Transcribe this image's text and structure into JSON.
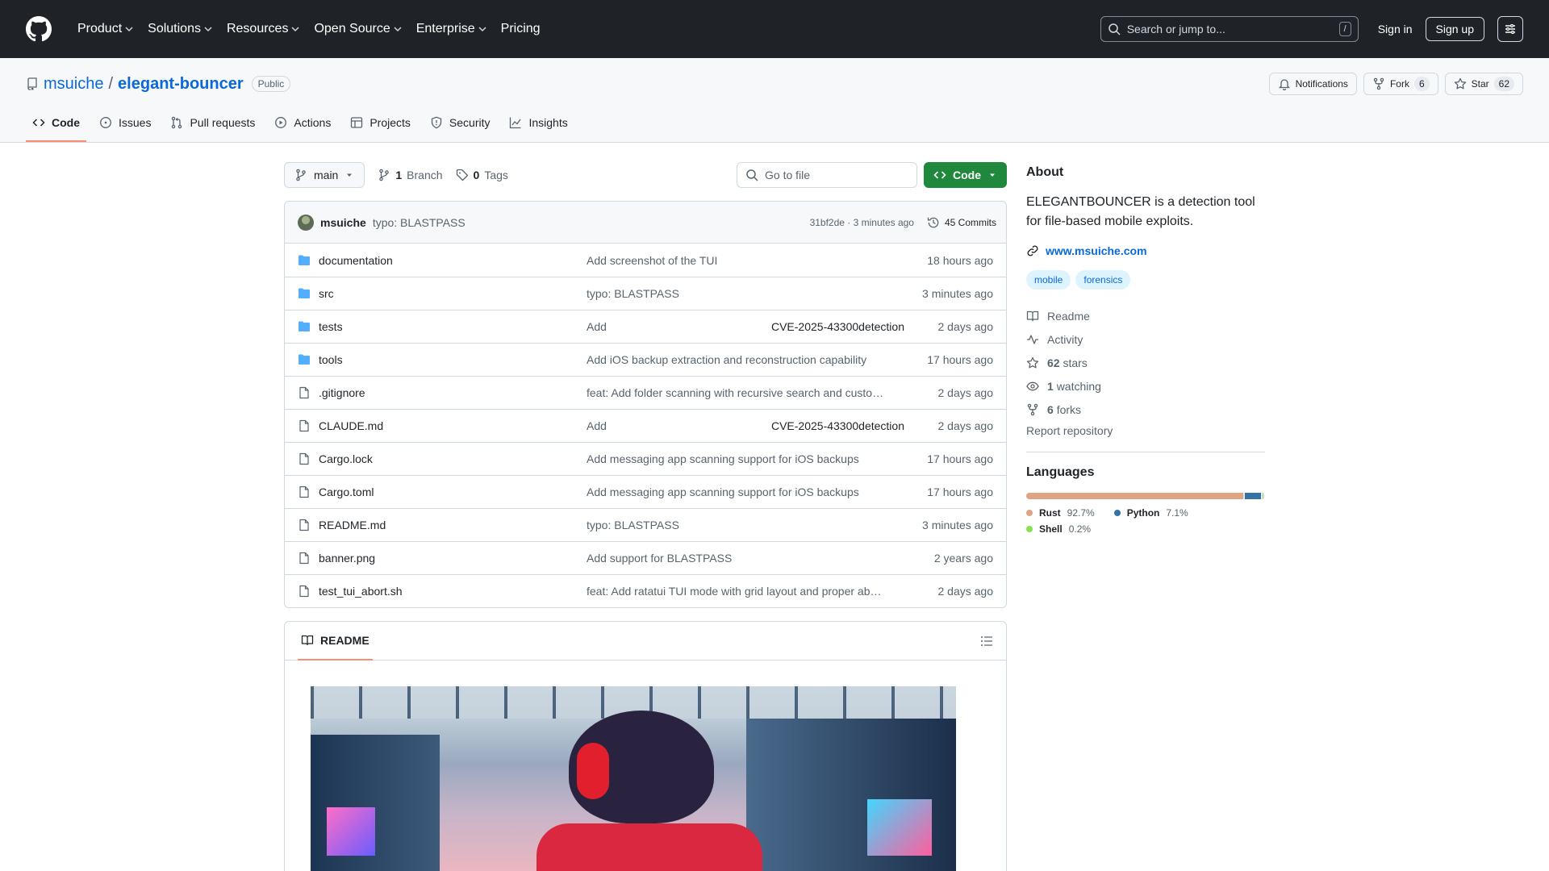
{
  "header": {
    "nav": [
      "Product",
      "Solutions",
      "Resources",
      "Open Source",
      "Enterprise",
      "Pricing"
    ],
    "search_placeholder": "Search or jump to...",
    "search_kbd": "/",
    "sign_in": "Sign in",
    "sign_up": "Sign up"
  },
  "repo": {
    "owner": "msuiche",
    "separator": "/",
    "name": "elegant-bouncer",
    "visibility": "Public",
    "notifications_label": "Notifications",
    "fork_label": "Fork",
    "fork_count": "6",
    "star_label": "Star",
    "star_count": "62"
  },
  "tabs": [
    "Code",
    "Issues",
    "Pull requests",
    "Actions",
    "Projects",
    "Security",
    "Insights"
  ],
  "file_nav": {
    "branch": "main",
    "branch_count": "1",
    "branch_label": "Branch",
    "tag_count": "0",
    "tag_label": "Tags",
    "goto_placeholder": "Go to file",
    "code_label": "Code"
  },
  "last_commit": {
    "author": "msuiche",
    "message": "typo: BLASTPASS",
    "sha_time": "31bf2de · 3 minutes ago",
    "commits_label": "45 Commits"
  },
  "files": [
    {
      "type": "dir",
      "name": "documentation",
      "commit": "Add screenshot of the TUI",
      "time": "18 hours ago"
    },
    {
      "type": "dir",
      "name": "src",
      "commit": "typo: BLASTPASS",
      "time": "3 minutes ago"
    },
    {
      "type": "dir",
      "name": "tests",
      "commit_pre": "Add ",
      "commit_link": "CVE-2025-43300",
      "commit_post": " detection",
      "time": "2 days ago"
    },
    {
      "type": "dir",
      "name": "tools",
      "commit": "Add iOS backup extraction and reconstruction capability",
      "time": "17 hours ago"
    },
    {
      "type": "file",
      "name": ".gitignore",
      "commit": "feat: Add folder scanning with recursive search and custom …",
      "time": "2 days ago"
    },
    {
      "type": "file",
      "name": "CLAUDE.md",
      "commit_pre": "Add ",
      "commit_link": "CVE-2025-43300",
      "commit_post": " detection",
      "time": "2 days ago"
    },
    {
      "type": "file",
      "name": "Cargo.lock",
      "commit": "Add messaging app scanning support for iOS backups",
      "time": "17 hours ago"
    },
    {
      "type": "file",
      "name": "Cargo.toml",
      "commit": "Add messaging app scanning support for iOS backups",
      "time": "17 hours ago"
    },
    {
      "type": "file",
      "name": "README.md",
      "commit": "typo: BLASTPASS",
      "time": "3 minutes ago"
    },
    {
      "type": "file",
      "name": "banner.png",
      "commit": "Add support for BLASTPASS",
      "time": "2 years ago"
    },
    {
      "type": "file",
      "name": "test_tui_abort.sh",
      "commit": "feat: Add ratatui TUI mode with grid layout and proper abort…",
      "time": "2 days ago"
    }
  ],
  "readme": {
    "tab_label": "README"
  },
  "about": {
    "title": "About",
    "description": "ELEGANTBOUNCER is a detection tool for file-based mobile exploits.",
    "website": "www.msuiche.com",
    "topics": [
      "mobile",
      "forensics"
    ],
    "readme_label": "Readme",
    "activity_label": "Activity",
    "stars_count": "62",
    "stars_label": "stars",
    "watching_count": "1",
    "watching_label": "watching",
    "forks_count": "6",
    "forks_label": "forks",
    "report_label": "Report repository"
  },
  "languages": {
    "title": "Languages",
    "items": [
      {
        "name": "Rust",
        "percent": "92.7%",
        "value": 92.7,
        "color": "#dea584"
      },
      {
        "name": "Python",
        "percent": "7.1%",
        "value": 7.1,
        "color": "#3572A5"
      },
      {
        "name": "Shell",
        "percent": "0.2%",
        "value": 0.2,
        "color": "#89e051"
      }
    ]
  }
}
